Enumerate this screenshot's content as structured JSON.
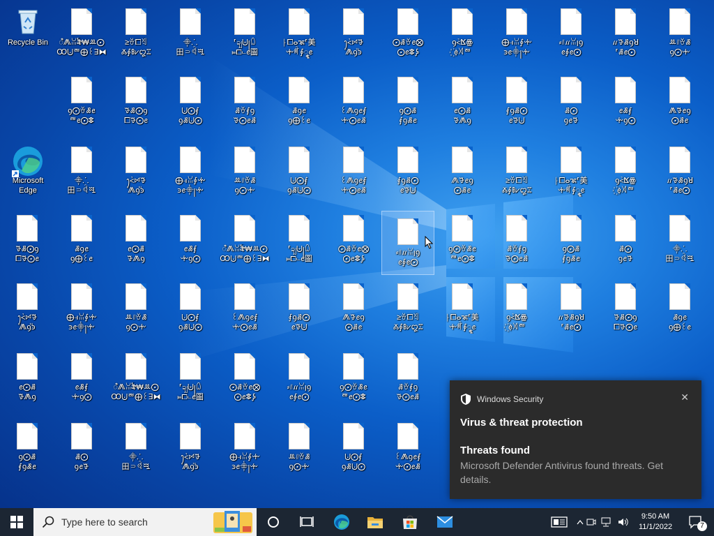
{
  "desktop": {
    "system_icons": [
      {
        "id": "recycle-bin",
        "label": "Recycle Bin",
        "icon": "recycle-bin-icon"
      },
      {
        "id": "microsoft-edge",
        "label": "Microsoft\nEdge",
        "icon": "edge-icon"
      }
    ],
    "file_icons": [
      {
        "label": "ꦶ⨇ꈍ꫟₩ꔛ⨀\nꝎ⨃ꥩ⨁꒰ꓱ⧓"
      },
      {
        "label": "≥ꈊ⧠ꈕ\nⰆ⨕ꗚ⩗꩓ꔙ"
      },
      {
        "label": "⸎⸫\n田⸧ꈽꗅ"
      },
      {
        "label": "⸢ꩾ⨄꧊꒧\n⫢⧠⨽ꫀ圖"
      },
      {
        "label": "⸠⧠ⴰꦨ⸢美\nꔺꈗ⨕ꦹꫀ"
      },
      {
        "label": "ꫂ⩻ꗯꗎ\nⷭ⨇ꝯⷳꜿ"
      },
      {
        "label": "⨀ꗡꈊꫀ⨂\n⨀ꫀꗵ⨔"
      },
      {
        "label": "ꝯ⩻ⴿꙮ\n꙰ꫀ꓀ꥩ"
      },
      {
        "label": "⨁⫣ꈍ⨕ꔺ\nꜿꫀ⸎꧊ꔺ"
      },
      {
        "label": "⸗᜶ꪵꈍꞁꝯ\nꫀ⨕ꫀ⨀"
      },
      {
        "label": "ꪵꗎꗡꝯꓤ\n⸢ꗡꫀ⨀"
      },
      {
        "label": "ꔛ᜶ꈊꗡ\nꝯ⨀ꔺ"
      },
      {
        "label": "ꝯ⨀ꈊꗡꫀ\nꥩꫀ⨀ꗵ"
      },
      {
        "label": "ꗎꗡ⨀ꝯ\n⧠ꗎ⨀ꫀ"
      },
      {
        "label": "⨃⨀⨐\nꝯꗡ⨃⨀"
      },
      {
        "label": "ꗡꈊ⨐ꝯ\nꗎ⨀ꫀꗡ"
      },
      {
        "label": "ꗡꝯꫀ\nꝯ⨁꒰ꫀ"
      },
      {
        "label": "꒰⨇ꝯꫀ⨐\nꔺ⨀ꫀꗡ"
      },
      {
        "label": "ꝯ⨀ꗡ\n⨐ꝯꗡꫀ"
      },
      {
        "label": "ꫀ⨀ꗡ\nꗎ⨇ꝯ"
      },
      {
        "label": "⨐ꝯꗡ⨀\nꫀꗎ⨃"
      },
      {
        "label": "ꗡ⨀\nꝯꫀꗎ"
      },
      {
        "label": "ꫀꗡ⨐\nꔺꝯ⨀"
      },
      {
        "label": "⨇ꗎꫀꝯ\n⨀ꗡꫀ"
      }
    ]
  },
  "toast": {
    "app_name": "Windows Security",
    "close_glyph": "✕",
    "title": "Virus & threat protection",
    "subtitle": "Threats found",
    "message": "Microsoft Defender Antivirus found threats. Get details."
  },
  "taskbar": {
    "search_placeholder": "Type here to search",
    "clock_time": "9:50 AM",
    "clock_date": "11/1/2022",
    "notification_count": "7"
  }
}
